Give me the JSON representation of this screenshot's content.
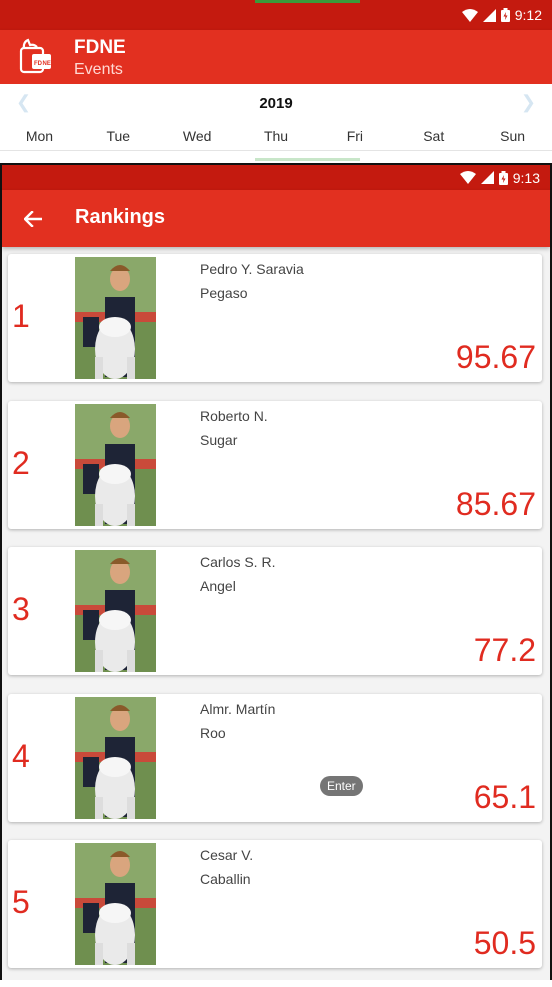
{
  "background": {
    "status_time": "9:12",
    "app_title": "FDNE",
    "app_subtitle": "Events",
    "calendar": {
      "year": "2019",
      "prev_icon": "chevron-left-icon",
      "next_icon": "chevron-right-icon",
      "days": [
        "Mon",
        "Tue",
        "Wed",
        "Thu",
        "Fri",
        "Sat",
        "Sun"
      ]
    }
  },
  "foreground": {
    "status_time": "9:13",
    "title": "Rankings",
    "back_icon": "arrow-back-icon"
  },
  "rankings": [
    {
      "rank": "1",
      "rider": "Pedro Y. Saravia",
      "horse": "Pegaso",
      "score": "95.67"
    },
    {
      "rank": "2",
      "rider": "Roberto N.",
      "horse": "Sugar",
      "score": "85.67"
    },
    {
      "rank": "3",
      "rider": "Carlos S. R.",
      "horse": "Angel",
      "score": "77.2"
    },
    {
      "rank": "4",
      "rider": "Almr. Martín",
      "horse": "Roo",
      "score": "65.1"
    },
    {
      "rank": "5",
      "rider": "Cesar V.",
      "horse": "Caballin",
      "score": "50.5"
    }
  ],
  "toast": "Enter",
  "colors": {
    "primary": "#e23020",
    "primary_dark": "#c41a0f",
    "accent_text": "#e02b20"
  }
}
